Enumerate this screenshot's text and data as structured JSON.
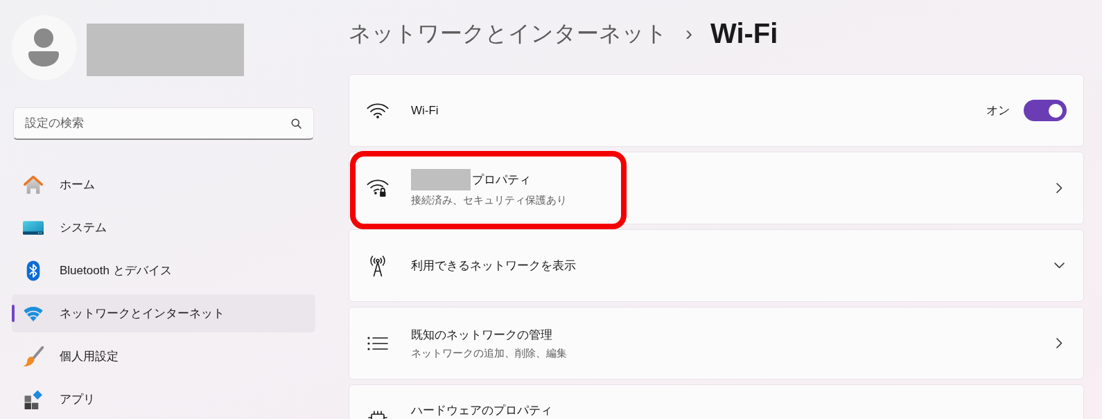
{
  "profile": {
    "name_redacted": true
  },
  "search": {
    "placeholder": "設定の検索"
  },
  "nav": [
    {
      "label": "ホーム",
      "selected": false
    },
    {
      "label": "システム",
      "selected": false
    },
    {
      "label": "Bluetooth とデバイス",
      "selected": false
    },
    {
      "label": "ネットワークとインターネット",
      "selected": true
    },
    {
      "label": "個人用設定",
      "selected": false
    },
    {
      "label": "アプリ",
      "selected": false
    }
  ],
  "breadcrumb": {
    "parent": "ネットワークとインターネット",
    "separator": "›",
    "current": "Wi-Fi"
  },
  "cards": [
    {
      "kind": "toggle",
      "title": "Wi-Fi",
      "state_label": "オン",
      "on": true,
      "highlighted": false
    },
    {
      "kind": "link",
      "title_redacted_prefix": true,
      "title": "プロパティ",
      "subtitle": "接続済み、セキュリティ保護あり",
      "highlighted": true
    },
    {
      "kind": "expander",
      "title": "利用できるネットワークを表示",
      "expanded": false,
      "highlighted": false
    },
    {
      "kind": "link",
      "title": "既知のネットワークの管理",
      "subtitle": "ネットワークの追加、削除、編集",
      "highlighted": false
    },
    {
      "title": "ハードウェアのプロパティ",
      "highlighted": false
    }
  ]
}
